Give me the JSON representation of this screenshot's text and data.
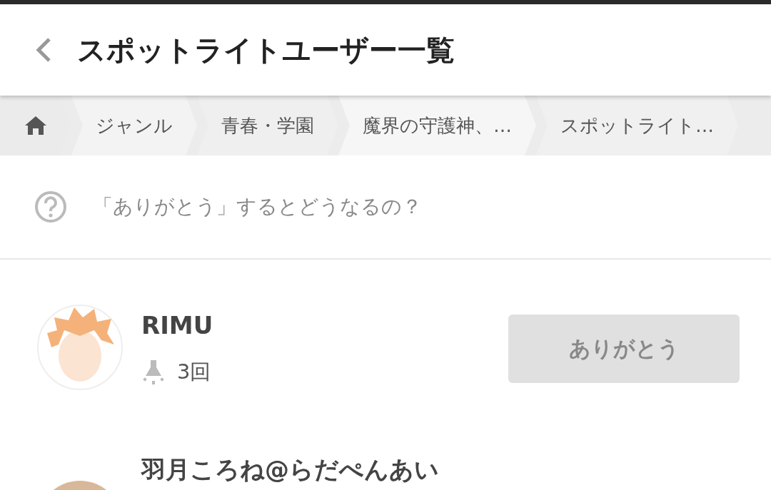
{
  "header": {
    "title": "スポットライトユーザー一覧"
  },
  "breadcrumbs": [
    {
      "kind": "home"
    },
    {
      "kind": "text",
      "label": "ジャンル"
    },
    {
      "kind": "text",
      "label": "青春・学園"
    },
    {
      "kind": "text",
      "label": "魔界の守護神、…"
    },
    {
      "kind": "text",
      "label": "スポットライト…"
    }
  ],
  "help": {
    "text": "「ありがとう」するとどうなるの？"
  },
  "users": [
    {
      "name": "RIMU",
      "count": "3回",
      "button": "ありがとう"
    },
    {
      "name": "羽月ころね@らだぺんあい"
    }
  ]
}
